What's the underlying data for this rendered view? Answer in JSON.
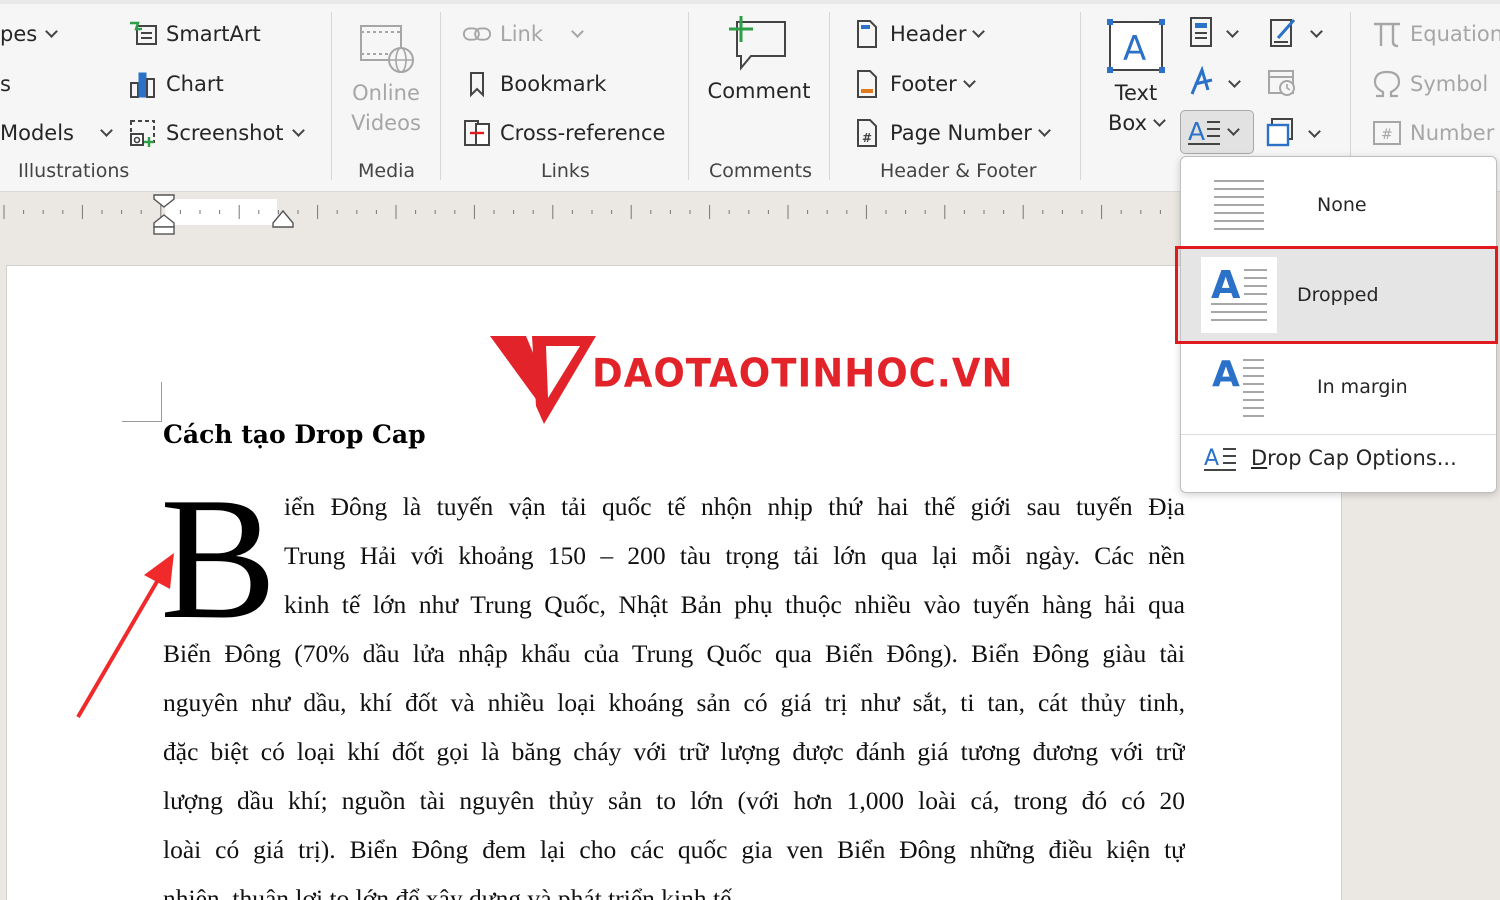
{
  "ribbon": {
    "illustrations": {
      "shapes_label": "pes",
      "icons_label": "s",
      "models_label": "Models",
      "smartart_label": "SmartArt",
      "chart_label": "Chart",
      "screenshot_label": "Screenshot",
      "group_label": "Illustrations"
    },
    "media": {
      "online_videos_line1": "Online",
      "online_videos_line2": "Videos",
      "group_label": "Media"
    },
    "links": {
      "link_label": "Link",
      "bookmark_label": "Bookmark",
      "cross_reference_label": "Cross-reference",
      "group_label": "Links"
    },
    "comments": {
      "comment_label": "Comment",
      "group_label": "Comments"
    },
    "header_footer": {
      "header_label": "Header",
      "footer_label": "Footer",
      "page_number_label": "Page Number",
      "group_label": "Header & Footer"
    },
    "text": {
      "text_box_line1": "Text",
      "text_box_line2": "Box"
    },
    "symbols": {
      "equation_label": "Equation",
      "symbol_label": "Symbol",
      "number_label": "Number"
    }
  },
  "dropcap_menu": {
    "items": [
      {
        "label": "None",
        "icon": "dropcap-none-icon",
        "selected": false
      },
      {
        "label": "Dropped",
        "icon": "dropcap-dropped-icon",
        "selected": true
      },
      {
        "label": "In margin",
        "icon": "dropcap-in-margin-icon",
        "selected": false
      }
    ],
    "options_label_u": "D",
    "options_label_rest": "rop Cap Options..."
  },
  "document": {
    "logo_text": "DAOTAOTINHOC.VN",
    "title": "Cách tạo Drop Cap",
    "drop_cap_letter": "B",
    "lines": [
      "iển Đông là tuyến vận tải quốc tế nhộn nhịp thứ hai thế giới sau tuyến Địa",
      "Trung Hải với khoảng 150 – 200 tàu trọng tải lớn qua lại mỗi ngày. Các nền",
      "kinh tế lớn như Trung Quốc, Nhật Bản phụ thuộc nhiều vào tuyến hàng hải qua",
      "Biển Đông (70% dầu lửa nhập khẩu của Trung Quốc qua Biển Đông). Biển Đông giàu tài",
      "nguyên như dầu, khí đốt và nhiều loại khoáng sản có giá trị như sắt, ti tan, cát thủy tinh,",
      "đặc biệt có loại khí đốt gọi là băng cháy với trữ lượng được đánh giá tương đương với trữ",
      "lượng dầu khí; nguồn tài nguyên thủy sản to lớn (với hơn 1,000 loài cá, trong đó có 20",
      "loài có giá trị). Biển Đông đem lại cho các quốc gia ven Biển Đông những điều kiện tự",
      "nhiên, thuận lợi to lớn để xây dựng và phát triển kinh tế."
    ]
  },
  "colors": {
    "highlight_red": "#e0191f",
    "accent_blue": "#2b71c7",
    "logo_red": "#e3232a"
  }
}
